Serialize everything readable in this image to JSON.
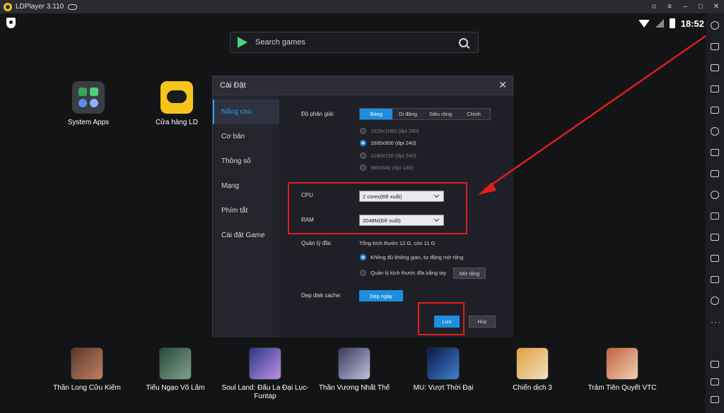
{
  "titlebar": {
    "app_title": "LDPlayer 3.110"
  },
  "statusbar": {
    "time": "18:52"
  },
  "search": {
    "placeholder": "Search games"
  },
  "desktop_apps": [
    {
      "label": "System Apps"
    },
    {
      "label": "Cửa hàng LD"
    }
  ],
  "dialog": {
    "title": "Cài Đặt",
    "nav": [
      "Nâng cao",
      "Cơ bản",
      "Thông số",
      "Mạng",
      "Phím tắt",
      "Cài đặt Game"
    ],
    "resolution": {
      "label": "Độ phân giải:",
      "modes": [
        "Bảng",
        "Di động",
        "Siêu rộng",
        "Chỉnh"
      ],
      "active_mode": "Bảng",
      "options": [
        "1920x1080  (dpi 280)",
        "1600x900  (dpi 240)",
        "1280x720  (dpi 240)",
        "960x540  (dpi 160)"
      ],
      "selected": "1600x900  (dpi 240)"
    },
    "cpu": {
      "label": "CPU",
      "value": "2 cores(Đề xuất)"
    },
    "ram": {
      "label": "RAM",
      "value": "2048M(Đề xuất)"
    },
    "disk": {
      "label": "Quản lý đĩa:",
      "info": "Tổng kích thước 12 G,  còn  11 G",
      "option_auto": "Không đủ không gian, tự động mở rộng",
      "option_manual": "Quản lý kích thước đĩa bằng tay",
      "expand_button": "Mở rộng"
    },
    "cache": {
      "label": "Dẹp disk cache:",
      "button": "Dẹp ngay"
    },
    "save_button": "Lưu",
    "cancel_button": "Hủy"
  },
  "games": [
    {
      "label": "Thần Long Cửu Kiếm"
    },
    {
      "label": "Tiếu Ngạo Võ Lâm"
    },
    {
      "label": "Soul Land: Đấu La Đại Lục-Funtap"
    },
    {
      "label": "Thần Vương Nhất Thế"
    },
    {
      "label": "MU: Vượt Thời Đại"
    },
    {
      "label": "Chiến dịch 3"
    },
    {
      "label": "Trảm Tiên Quyết VTC"
    }
  ],
  "colors": {
    "accent": "#1e8fe0",
    "annotation": "#e11d1d",
    "store_yellow": "#f7c51a"
  }
}
